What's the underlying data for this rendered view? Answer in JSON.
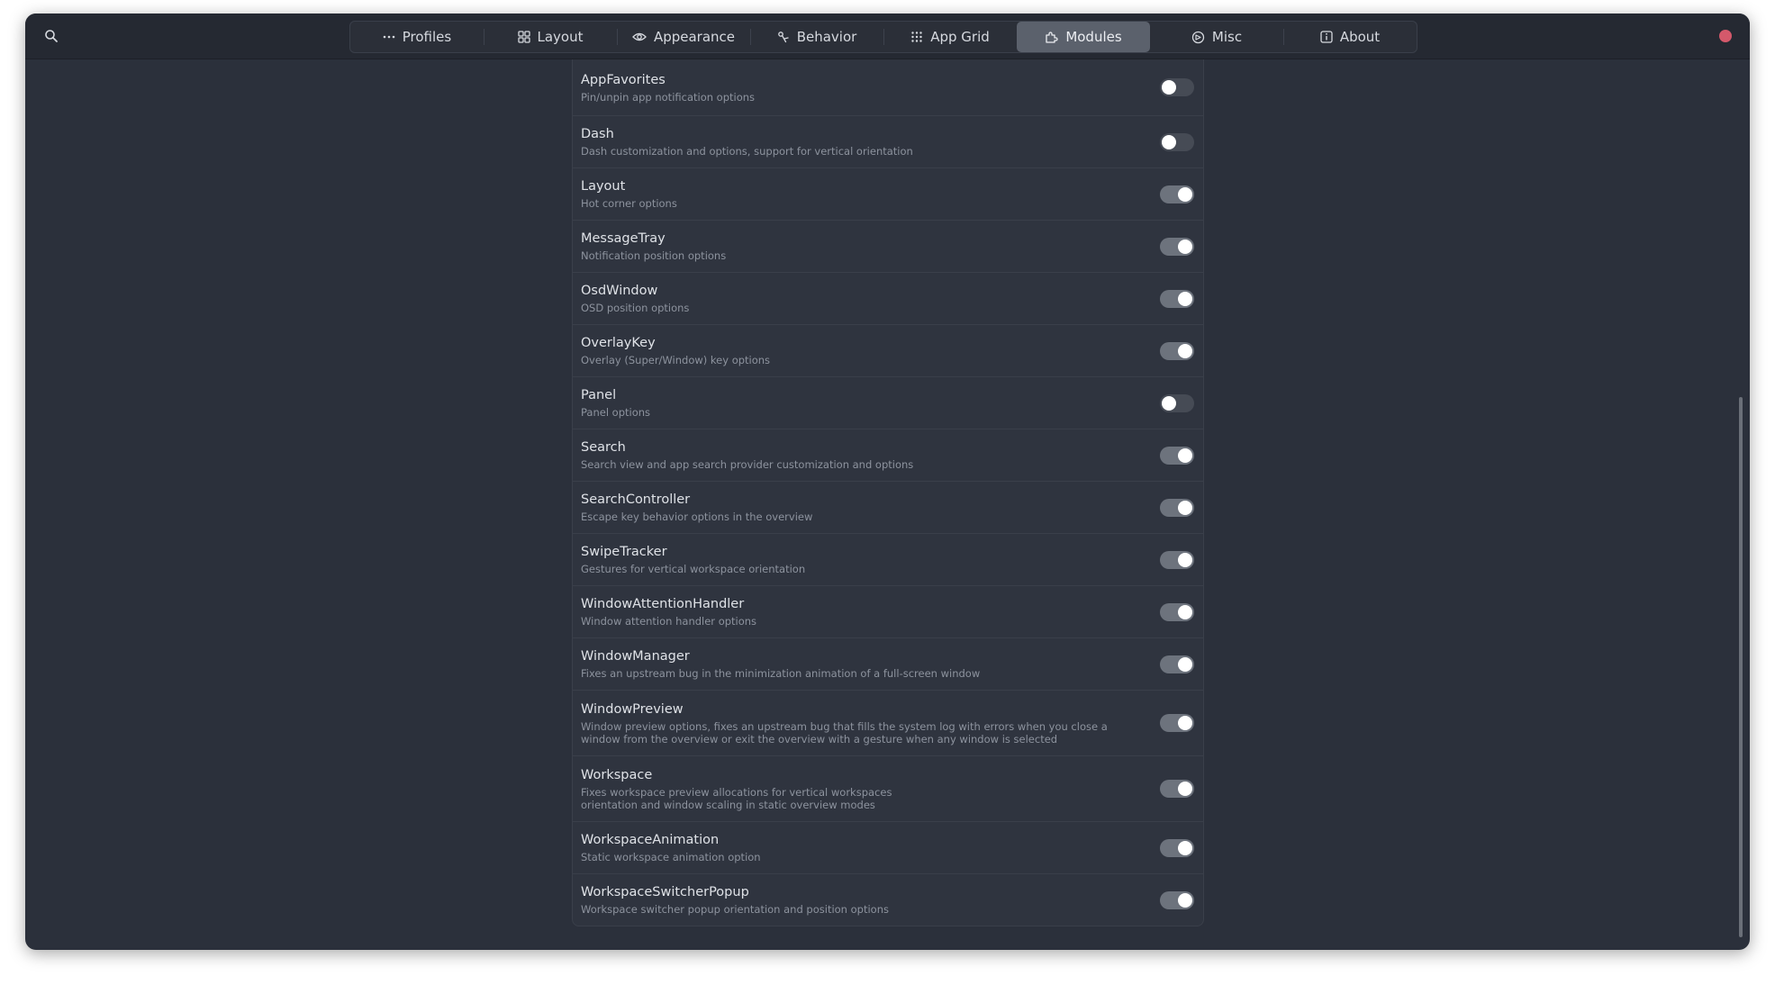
{
  "colors": {
    "window_bg": "#2b303b",
    "header_bg": "#252932",
    "active_tab": "#5b616c",
    "close_button": "#d4596b",
    "switch_on": "#6d737d",
    "switch_off": "#464b55"
  },
  "header": {
    "search_icon": "search-icon",
    "close_icon": "close-dot-icon",
    "tabs": [
      {
        "label": "Profiles",
        "icon": "dots-icon"
      },
      {
        "label": "Layout",
        "icon": "layout-grid-icon"
      },
      {
        "label": "Appearance",
        "icon": "eye-icon"
      },
      {
        "label": "Behavior",
        "icon": "behavior-icon"
      },
      {
        "label": "App Grid",
        "icon": "app-grid-icon"
      },
      {
        "label": "Modules",
        "icon": "puzzle-icon",
        "active": true
      },
      {
        "label": "Misc",
        "icon": "misc-icon"
      },
      {
        "label": "About",
        "icon": "info-icon"
      }
    ]
  },
  "modules": [
    {
      "title": "AppFavorites",
      "subtitle": "Pin/unpin app notification options",
      "enabled": false
    },
    {
      "title": "Dash",
      "subtitle": "Dash customization and options, support for vertical orientation",
      "enabled": false
    },
    {
      "title": "Layout",
      "subtitle": "Hot corner options",
      "enabled": true
    },
    {
      "title": "MessageTray",
      "subtitle": "Notification position options",
      "enabled": true
    },
    {
      "title": "OsdWindow",
      "subtitle": "OSD position options",
      "enabled": true
    },
    {
      "title": "OverlayKey",
      "subtitle": "Overlay (Super/Window) key options",
      "enabled": true
    },
    {
      "title": "Panel",
      "subtitle": "Panel options",
      "enabled": false
    },
    {
      "title": "Search",
      "subtitle": "Search view and app search provider customization and options",
      "enabled": true
    },
    {
      "title": "SearchController",
      "subtitle": "Escape key behavior options in the overview",
      "enabled": true
    },
    {
      "title": "SwipeTracker",
      "subtitle": "Gestures for vertical workspace orientation",
      "enabled": true
    },
    {
      "title": "WindowAttentionHandler",
      "subtitle": "Window attention handler options",
      "enabled": true
    },
    {
      "title": "WindowManager",
      "subtitle": "Fixes an upstream bug in the minimization animation of a full-screen window",
      "enabled": true
    },
    {
      "title": "WindowPreview",
      "subtitle": "Window preview options, fixes an upstream bug that fills the system log with errors when you close a window from the overview or exit the overview with a gesture when any window is selected",
      "enabled": true
    },
    {
      "title": "Workspace",
      "subtitle": "Fixes workspace preview allocations for vertical workspaces orientation and window scaling in static overview modes",
      "enabled": true
    },
    {
      "title": "WorkspaceAnimation",
      "subtitle": "Static workspace animation option",
      "enabled": true
    },
    {
      "title": "WorkspaceSwitcherPopup",
      "subtitle": "Workspace switcher popup orientation and position options",
      "enabled": true
    }
  ]
}
